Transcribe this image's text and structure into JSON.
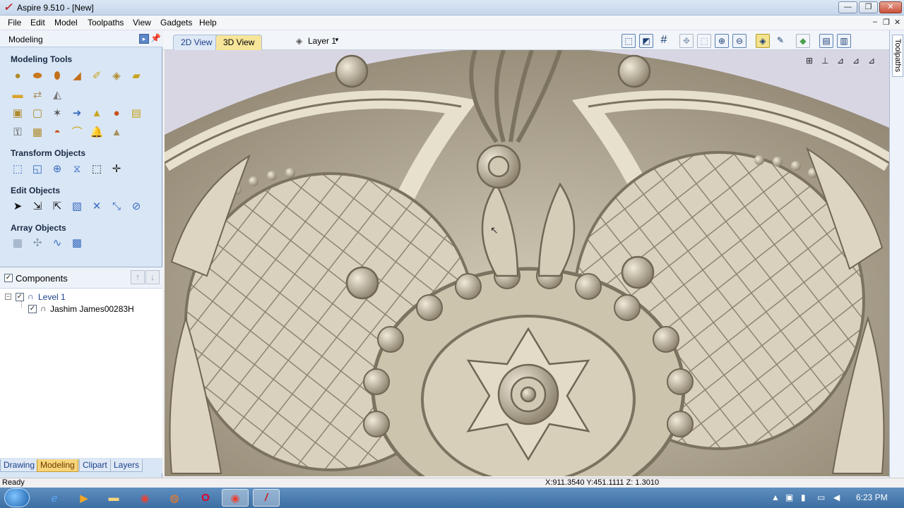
{
  "window": {
    "title": "Aspire 9.510 - [New]",
    "minimize": "—",
    "maximize": "❐",
    "close": "✕"
  },
  "menubar": {
    "items": [
      "File",
      "Edit",
      "Model",
      "Toolpaths",
      "View",
      "Gadgets",
      "Help"
    ],
    "mdi_min": "–",
    "mdi_restore": "❐",
    "mdi_close": "✕"
  },
  "left_panel": {
    "header": "Modeling",
    "sections": {
      "modeling_tools": "Modeling Tools",
      "transform_objects": "Transform Objects",
      "edit_objects": "Edit Objects",
      "array_objects": "Array Objects"
    },
    "components": {
      "title": "Components",
      "tree": {
        "level": "Level 1",
        "item": "Jashim James00283H"
      }
    },
    "tabs": [
      "Drawing",
      "Modeling",
      "Clipart",
      "Layers"
    ],
    "active_tab": "Modeling"
  },
  "view_toolbar": {
    "tabs": [
      "2D View",
      "3D View"
    ],
    "active_tab": "3D View",
    "layer_selector": "Layer 1"
  },
  "right_strip": {
    "label": "Toolpaths"
  },
  "status": {
    "left": "Ready",
    "coords": "X:911.3540 Y:451.1111 Z: 1.3010"
  },
  "taskbar": {
    "clock": "6:23 PM"
  },
  "colors": {
    "panel_bg": "#d9e6f5",
    "active_tab": "#f7d57a",
    "relief": "#c9c0ab"
  }
}
